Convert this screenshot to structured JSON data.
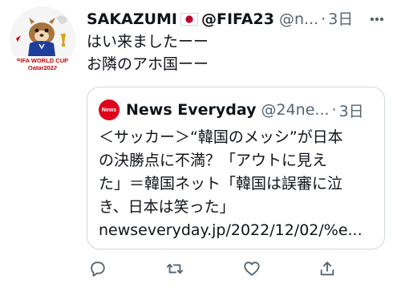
{
  "tweet": {
    "display_name": "SAKAZUMI",
    "flag_icon": "japan-flag-icon",
    "handle": "@FIFA23",
    "handle_secondary": "@n...",
    "separator": "·",
    "time": "3日",
    "lines": [
      "はい来ましたーー",
      "お隣のアホ国ーー"
    ],
    "avatar": {
      "icon": "fifa-world-cup-mascot-avatar",
      "caption_line1": "FIFA WORLD CUP",
      "caption_line2": "Qatar2022"
    }
  },
  "quote": {
    "display_name": "News Everyday",
    "handle": "@24ne...",
    "separator": "·",
    "time": "3日",
    "avatar_label": "News",
    "lines": [
      "＜サッカー＞“韓国のメッシ”が日本",
      "の決勝点に不満？「アウトに見え",
      "た」＝韓国ネット「韓国は誤審に泣",
      "き、日本は笑った」",
      "newseveryday.jp/2022/12/02/%e..."
    ]
  },
  "actions": [
    {
      "name": "reply",
      "icon": "reply-icon"
    },
    {
      "name": "retweet",
      "icon": "retweet-icon"
    },
    {
      "name": "like",
      "icon": "heart-icon"
    },
    {
      "name": "share",
      "icon": "share-icon"
    }
  ],
  "colors": {
    "text": "#0f1419",
    "secondary": "#536471",
    "border": "#cfd9de",
    "news_red": "#e0001b"
  }
}
